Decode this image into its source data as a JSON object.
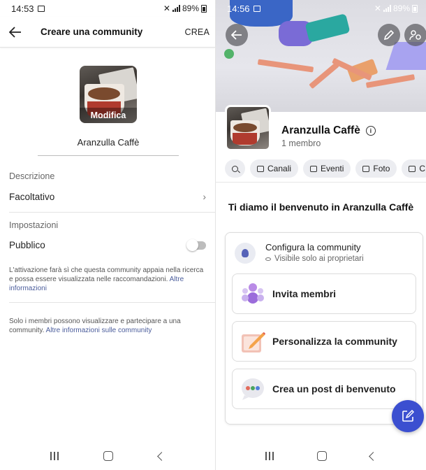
{
  "left": {
    "status": {
      "time": "14:53",
      "battery": "89%"
    },
    "header": {
      "title": "Creare una community",
      "action": "CREA"
    },
    "avatar": {
      "label": "Modifica"
    },
    "name_value": "Aranzulla Caffè",
    "description": {
      "label": "Descrizione",
      "value": "Facoltativo"
    },
    "settings": {
      "label": "Impostazioni",
      "public_label": "Pubblico",
      "public_on": false,
      "note_text": "L'attivazione farà sì che questa community appaia nella ricerca e possa essere visualizzata nelle raccomandazioni.",
      "note_link": "Altre informazioni"
    },
    "footer": {
      "text": "Solo i membri possono visualizzare e partecipare a una community.",
      "link": "Altre informazioni sulle community"
    }
  },
  "right": {
    "status": {
      "time": "14:56",
      "battery": "89%"
    },
    "community_name": "Aranzulla Caffè",
    "members": "1 membro",
    "tabs": [
      "Canali",
      "Eventi",
      "Foto",
      "C"
    ],
    "welcome": "Ti diamo il benvenuto in Aranzulla Caffè",
    "configure": {
      "title": "Configura la community",
      "subtitle": "Visibile solo ai proprietari"
    },
    "actions": [
      "Invita membri",
      "Personalizza la community",
      "Crea un post di benvenuto"
    ]
  },
  "colors": {
    "accent": "#3b4fd0",
    "link": "#4a5c9b"
  }
}
